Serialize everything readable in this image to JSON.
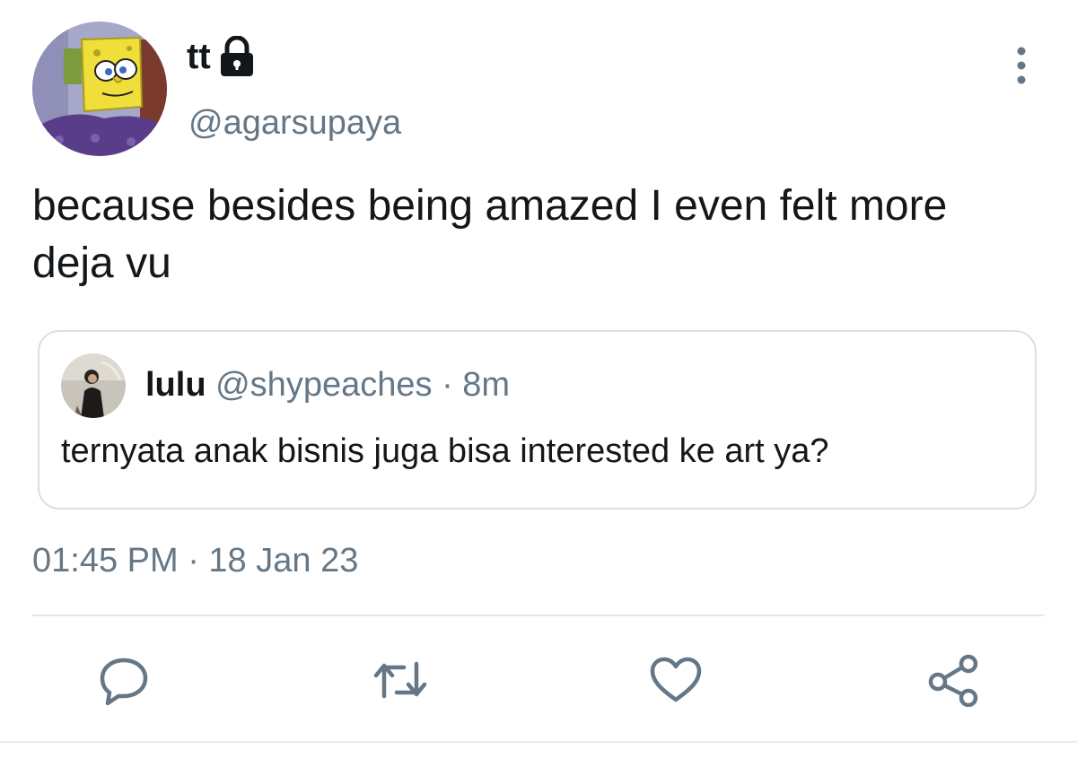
{
  "tweet": {
    "author": {
      "display_name": "tt",
      "handle": "@agarsupaya",
      "protected_icon": "lock-icon",
      "avatar_icon": "cartoon-sponge-avatar"
    },
    "text": "because besides being amazed I even felt more deja vu",
    "timestamp": "01:45 PM · 18 Jan 23"
  },
  "quoted_tweet": {
    "display_name": "lulu",
    "handle": "@shypeaches",
    "separator": "·",
    "age": "8m",
    "text": "ternyata anak bisnis juga bisa interested ke art ya?",
    "avatar_icon": "person-photo-avatar"
  },
  "actions": {
    "reply_icon": "reply-icon",
    "retweet_icon": "retweet-icon",
    "like_icon": "heart-icon",
    "share_icon": "share-icon",
    "more_icon": "more-vertical-icon"
  },
  "colors": {
    "text_primary": "#14171a",
    "text_secondary": "#657786",
    "border": "#d9dfe4",
    "icon": "#657786"
  }
}
